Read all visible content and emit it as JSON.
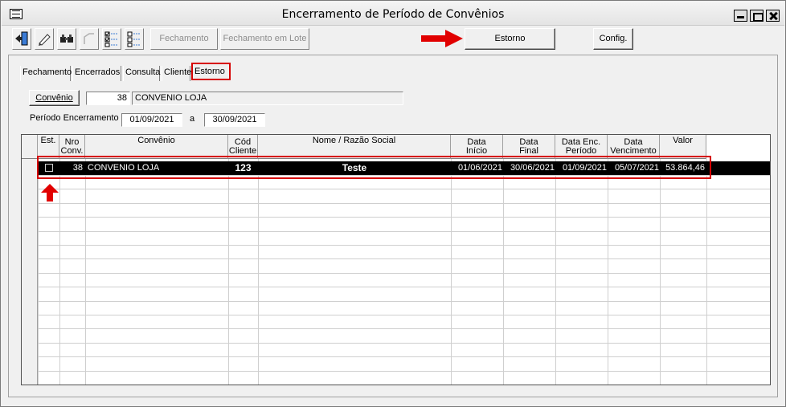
{
  "window": {
    "title": "Encerramento de Período de Convênios"
  },
  "toolbar": {
    "fechamento": "Fechamento",
    "fechamento_lote": "Fechamento em Lote",
    "estorno": "Estorno",
    "config": "Config."
  },
  "tabs": [
    "Fechamento",
    "Encerrados",
    "Consulta",
    "Cliente",
    "Estorno"
  ],
  "filters": {
    "convenio_button": "Convênio",
    "convenio_code": "38",
    "convenio_name": "CONVENIO LOJA",
    "periodo_label": "Período Encerramento",
    "periodo_start": "01/09/2021",
    "periodo_sep": "a",
    "periodo_end": "30/09/2021"
  },
  "grid": {
    "headers": {
      "est": "Est.",
      "nro": [
        "Nro",
        "Conv."
      ],
      "convenio": "Convênio",
      "cod": [
        "Cód",
        "Cliente"
      ],
      "nome": "Nome / Razão Social",
      "data_inicio": [
        "Data",
        "Início"
      ],
      "data_final": [
        "Data",
        "Final"
      ],
      "data_enc": [
        "Data Enc.",
        "Período"
      ],
      "data_venc": [
        "Data",
        "Vencimento"
      ],
      "valor": "Valor"
    },
    "row": {
      "nro": "38",
      "convenio": "CONVENIO LOJA",
      "cod": "123",
      "nome": "Teste",
      "data_inicio": "01/06/2021",
      "data_final": "30/06/2021",
      "data_enc": "01/09/2021",
      "data_venc": "05/07/2021",
      "valor": "53.864,46"
    }
  },
  "colors": {
    "highlight": "#d60000",
    "selected_row": "#000000"
  }
}
